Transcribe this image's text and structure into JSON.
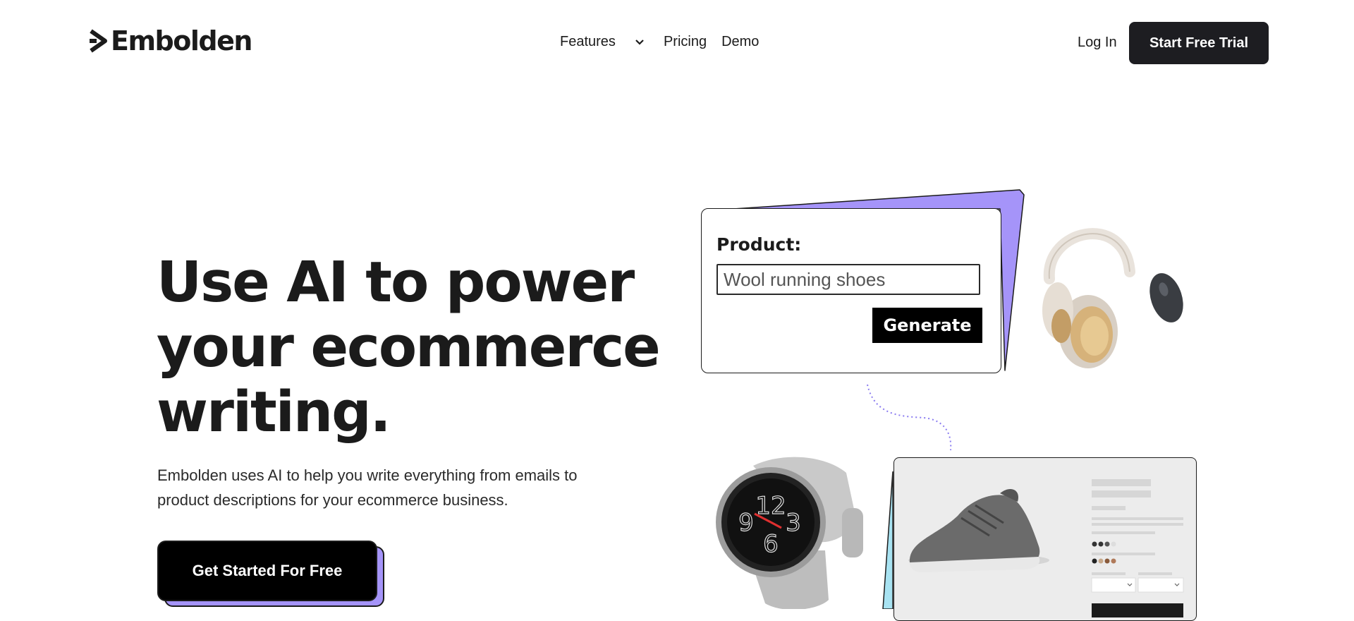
{
  "nav": {
    "brand": "Embolden",
    "menu": [
      {
        "label": "Features",
        "has_dropdown": true
      },
      {
        "label": "Pricing"
      },
      {
        "label": "Demo"
      }
    ],
    "login_label": "Log In",
    "trial_label": "Start Free Trial"
  },
  "hero": {
    "headline": "Use AI to power your ecommerce writing.",
    "subtext": "Embolden uses AI to help you write everything from emails to product descriptions for your ecommerce business.",
    "cta_label": "Get Started For Free"
  },
  "demo_card": {
    "label": "Product:",
    "input_value": "Wool running shoes",
    "button_label": "Generate"
  },
  "colors": {
    "accent_purple": "#a594f9",
    "accent_cyan": "#a8e3f2",
    "dark": "#1d1d21"
  },
  "icons": [
    "logo-arrow-icon",
    "chevron-down-icon"
  ]
}
